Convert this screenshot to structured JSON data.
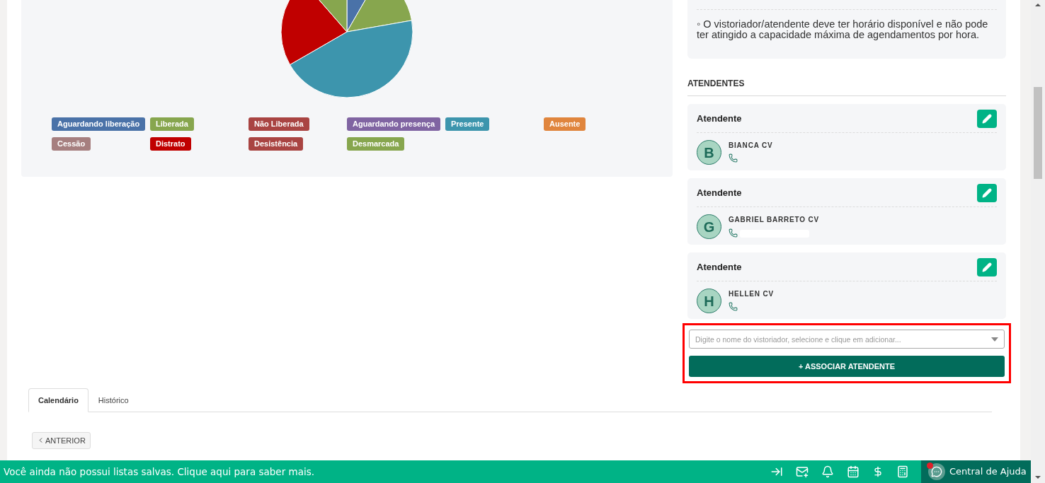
{
  "chart_legend": [
    {
      "label": "Aguardando liberação",
      "color": "#4a72a8"
    },
    {
      "label": "Liberada",
      "color": "#87a64e"
    },
    {
      "label": "Não Liberada",
      "color": "#a94442"
    },
    {
      "label": "Aguardando presença",
      "color": "#8064a2"
    },
    {
      "label": "Presente",
      "color": "#3d95ad"
    },
    {
      "label": "Ausente",
      "color": "#e0853d"
    },
    {
      "label": "Cessão",
      "color": "#a67f7f"
    },
    {
      "label": "Distrato",
      "color": "#c00000"
    },
    {
      "label": "Desistência",
      "color": "#a94442"
    },
    {
      "label": "Desmarcada",
      "color": "#87a64e"
    }
  ],
  "rules_box": {
    "text": "◦ O vistoriador/atendente deve ter horário disponível e não pode ter atingido a capacidade máxima de agendamentos por hora."
  },
  "attendants_section": {
    "title": "ATENDENTES",
    "attendants": [
      {
        "role": "Atendente",
        "initial": "B",
        "name": "BIANCA CV",
        "phone_redacted": false
      },
      {
        "role": "Atendente",
        "initial": "G",
        "name": "GABRIEL BARRETO CV",
        "phone_redacted": true
      },
      {
        "role": "Atendente",
        "initial": "H",
        "name": "HELLEN CV",
        "phone_redacted": false
      }
    ],
    "associate": {
      "highlighted": true,
      "placeholder": "Digite o nome do vistoriador, selecione e clique em adicionar...",
      "button": "+ ASSOCIAR ATENDENTE"
    }
  },
  "tabs": [
    {
      "label": "Calendário",
      "selected": true
    },
    {
      "label": "Histórico",
      "selected": false
    }
  ],
  "previous_button": "ANTERIOR",
  "status_bar": {
    "message": "Você ainda não possui listas salvas. Clique aqui para saber mais.",
    "help": {
      "label": "Central de Ajuda",
      "notification": true
    }
  }
}
